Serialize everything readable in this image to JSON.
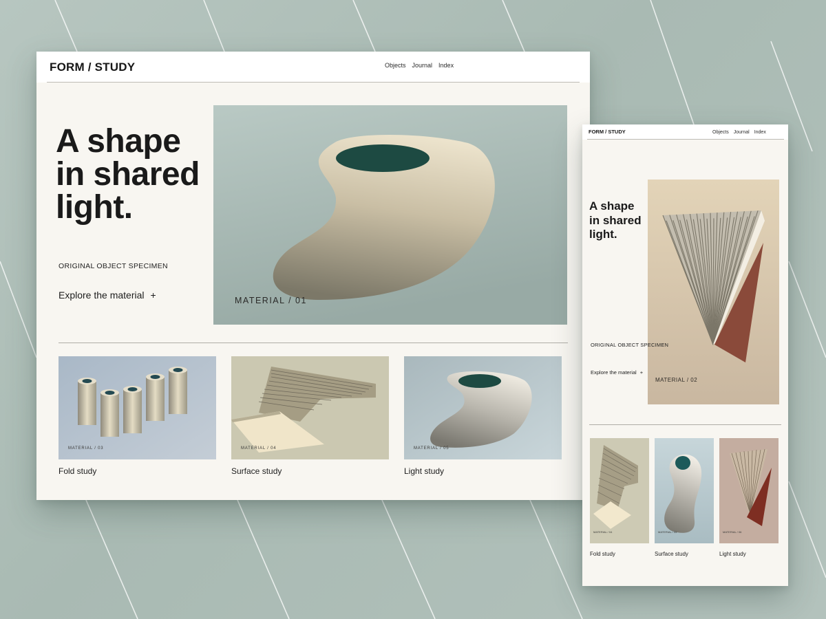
{
  "desktop": {
    "logo": "FORM / STUDY",
    "nav": [
      "Objects",
      "Journal",
      "Index"
    ],
    "hero": {
      "title_lines": [
        "A shape",
        "in shared",
        "light."
      ],
      "kicker": "ORIGINAL OBJECT SPECIMEN",
      "cta_label": "Explore the material",
      "cta_icon": "+",
      "image_label": "MATERIAL / 01"
    },
    "cards": [
      {
        "label": "MATERIAL / 03",
        "caption": "Fold study"
      },
      {
        "label": "MATERIAL / 04",
        "caption": "Surface study"
      },
      {
        "label": "MATERIAL / 05",
        "caption": "Light study"
      }
    ]
  },
  "mobile": {
    "logo": "FORM / STUDY",
    "nav": [
      "Objects",
      "Journal",
      "Index"
    ],
    "hero": {
      "title_lines": [
        "A shape",
        "in shared",
        "light."
      ],
      "kicker": "ORIGINAL OBJECT SPECIMEN",
      "cta_label": "Explore the material",
      "cta_icon": "+",
      "image_label": "MATERIAL / 02"
    },
    "cards": [
      {
        "label": "MATERIAL / 04",
        "caption": "Fold study"
      },
      {
        "label": "MATERIAL / 05",
        "caption": "Surface study"
      },
      {
        "label": "MATERIAL / 06",
        "caption": "Light study"
      }
    ]
  },
  "colors": {
    "background": "#b0c0ba",
    "page": "#f8f6f1",
    "accent_teal": "#1d4a42",
    "accent_rust": "#8a4a3a"
  }
}
